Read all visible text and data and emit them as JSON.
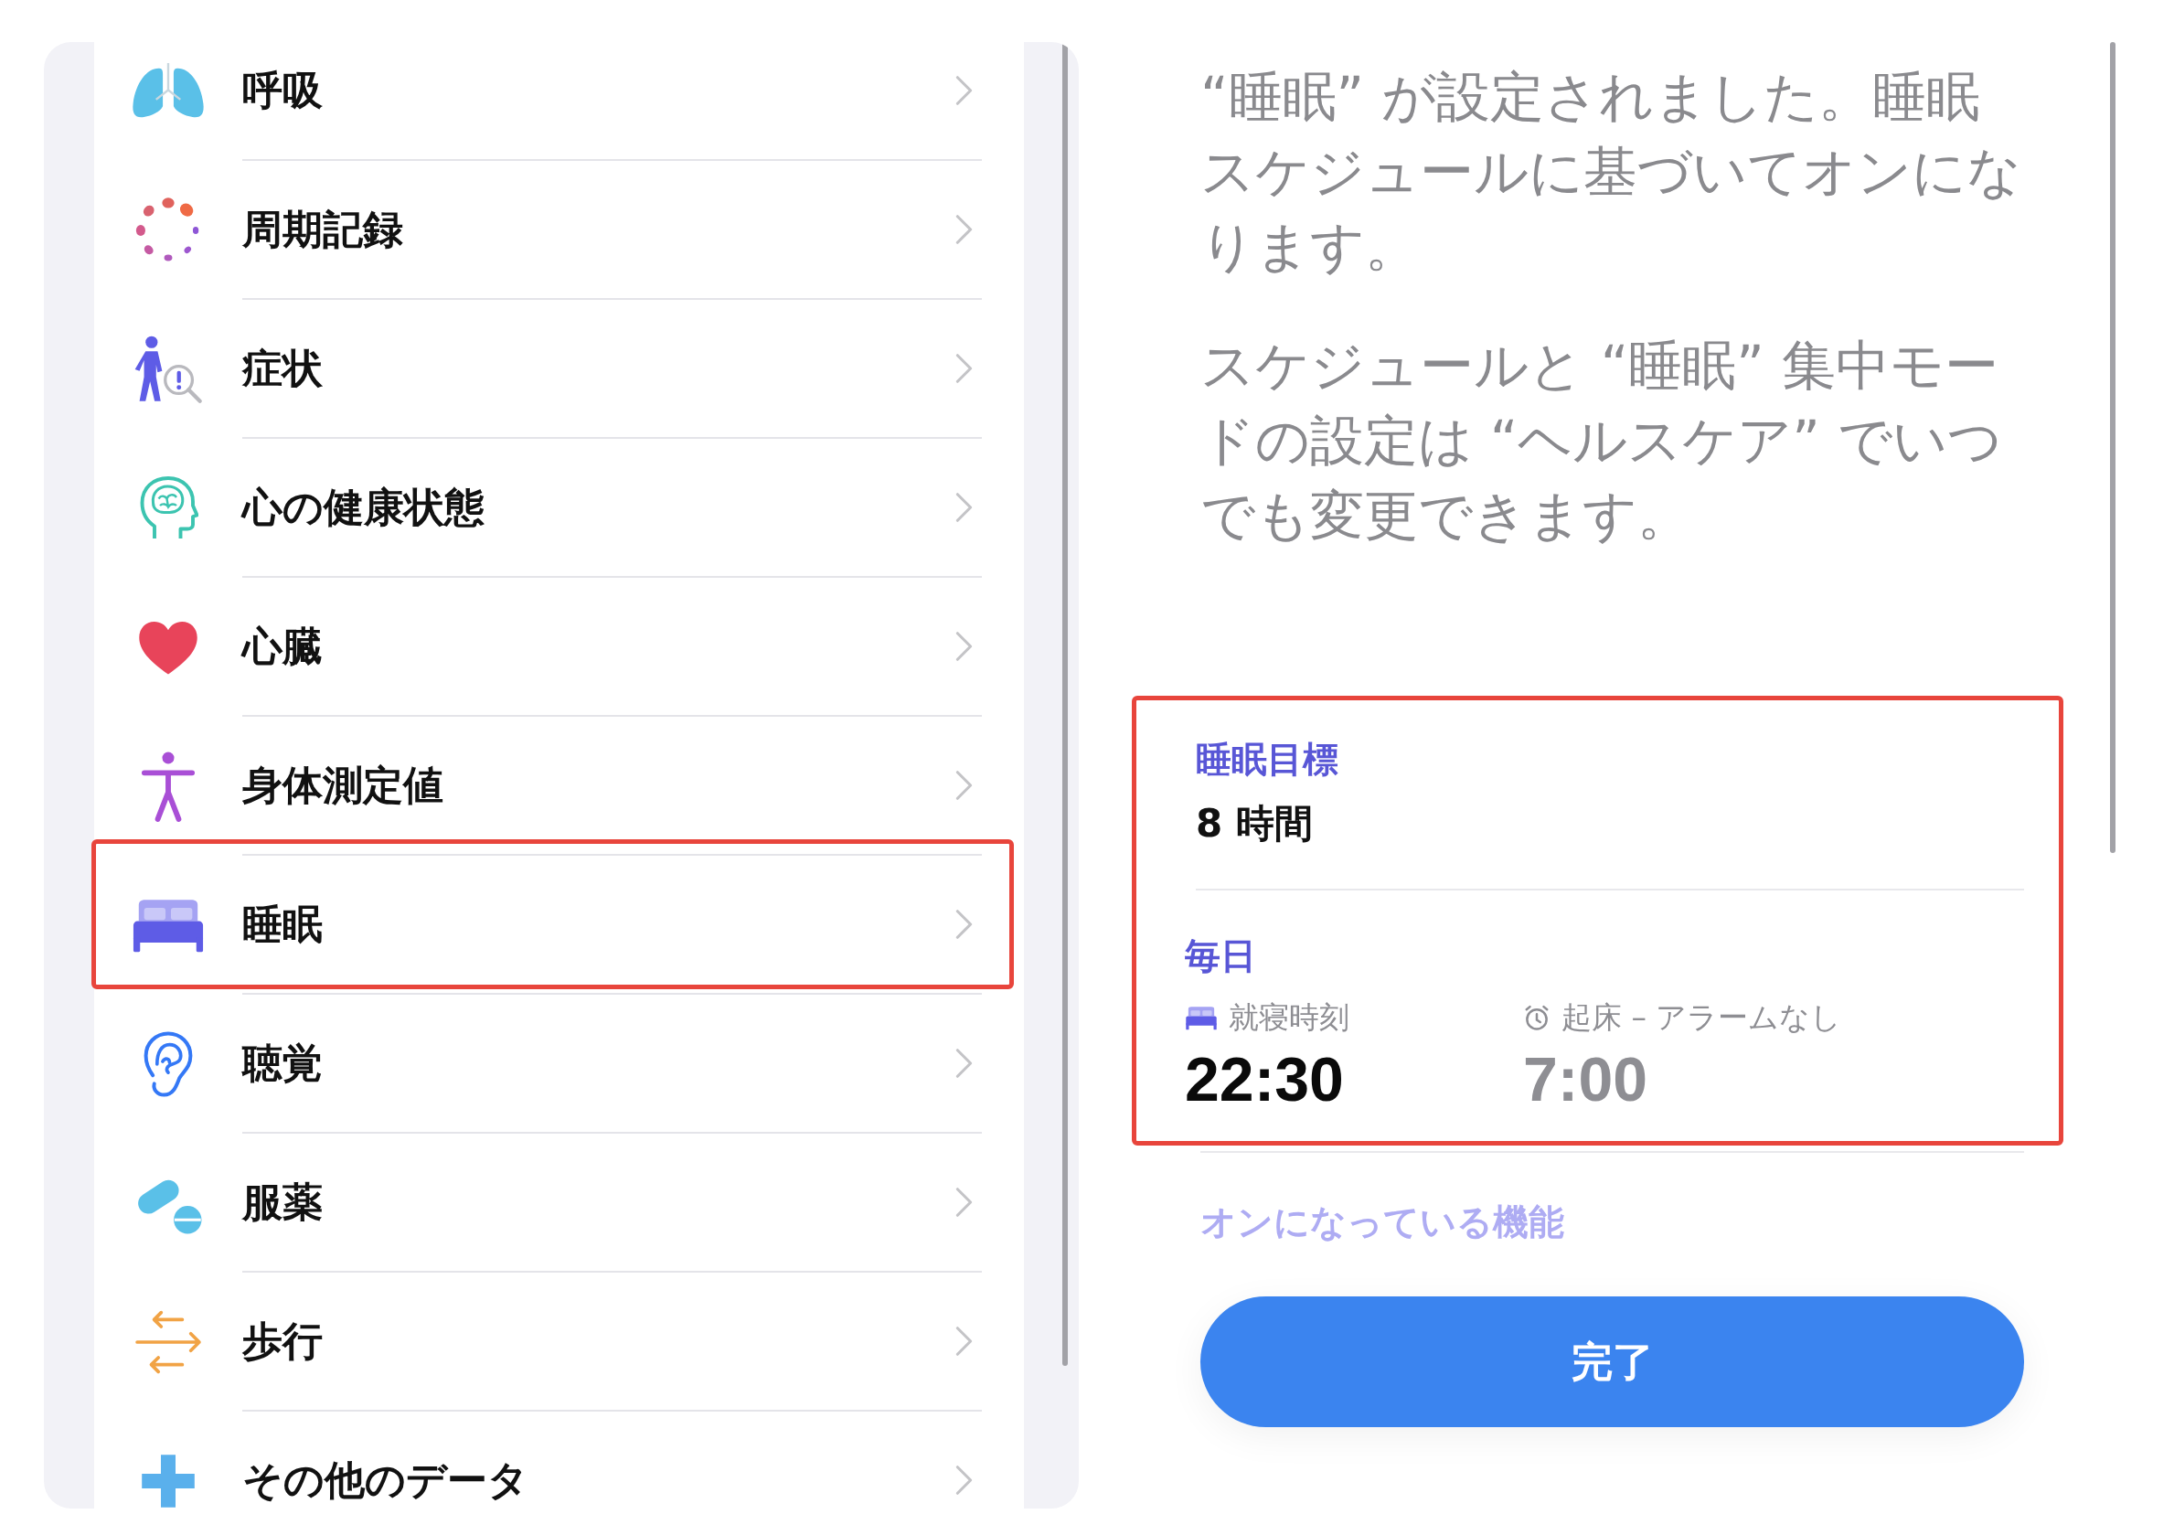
{
  "categories": {
    "items": [
      {
        "label": "呼吸",
        "highlighted": false
      },
      {
        "label": "周期記録",
        "highlighted": false
      },
      {
        "label": "症状",
        "highlighted": false
      },
      {
        "label": "心の健康状態",
        "highlighted": false
      },
      {
        "label": "心臓",
        "highlighted": false
      },
      {
        "label": "身体測定値",
        "highlighted": false
      },
      {
        "label": "睡眠",
        "highlighted": true
      },
      {
        "label": "聴覚",
        "highlighted": false
      },
      {
        "label": "服薬",
        "highlighted": false
      },
      {
        "label": "歩行",
        "highlighted": false
      },
      {
        "label": "その他のデータ",
        "highlighted": false
      }
    ]
  },
  "sleep_setup": {
    "paragraphs": [
      "“睡眠” が設定されました。睡眠スケジュールに基づいてオンになります。",
      "スケジュールと “睡眠” 集中モードの設定は “ヘルスケア” でいつでも変更できます。"
    ],
    "schedule": {
      "highlighted": true,
      "goal_label": "睡眠目標",
      "goal_value": "8 時間",
      "frequency": "毎日",
      "bedtime": {
        "label": "就寝時刻",
        "time": "22:30",
        "dimmed": false
      },
      "wake": {
        "label": "起床 – アラームなし",
        "time": "7:00",
        "dimmed": true
      }
    },
    "features_heading": "オンになっている機能",
    "done_button": "完了"
  }
}
